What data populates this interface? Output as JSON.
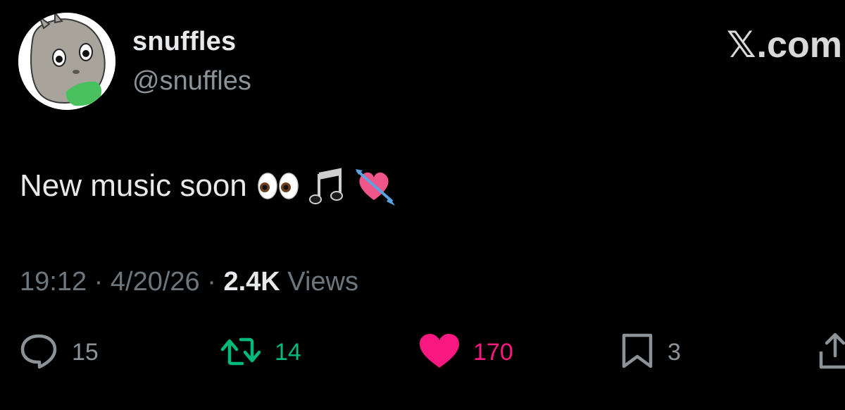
{
  "author": {
    "display_name": "snuffles",
    "handle": "@snuffles"
  },
  "brand": {
    "x_mark": "𝕏",
    "domain": ".com"
  },
  "tweet": {
    "text": "New music soon",
    "emojis": [
      "eyes-emoji",
      "musical-notes-emoji",
      "heart-with-arrow-emoji"
    ]
  },
  "meta": {
    "time": "19:12",
    "separator": "·",
    "date": "4/20/26",
    "views_count": "2.4K",
    "views_label": "Views"
  },
  "actions": {
    "replies": "15",
    "reposts": "14",
    "likes": "170",
    "bookmarks": "3"
  },
  "colors": {
    "background": "#000000",
    "text": "#e7e9ea",
    "secondary": "#8b9298",
    "repost_green": "#00ba7c",
    "like_pink": "#f91880"
  }
}
